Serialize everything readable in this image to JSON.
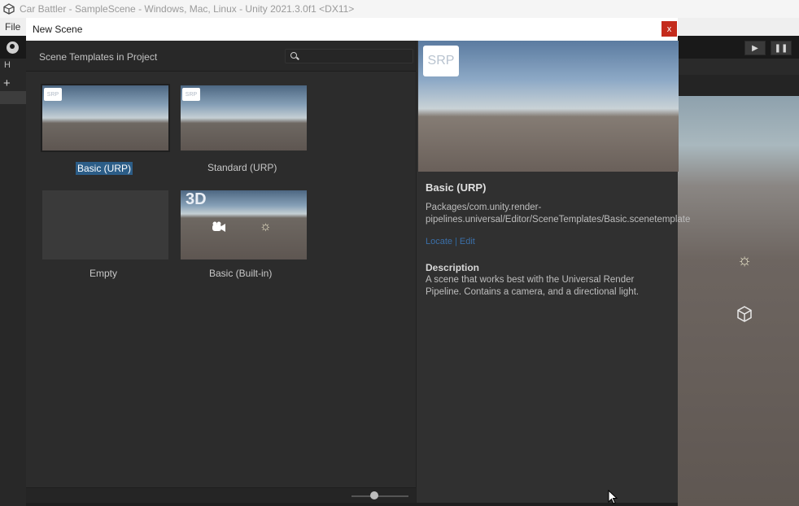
{
  "window": {
    "title": "Car Battler - SampleScene - Windows, Mac, Linux - Unity 2021.3.0f1 <DX11>",
    "menu": [
      "File"
    ]
  },
  "hierarchy": {
    "tab_label": "H"
  },
  "dialog": {
    "title": "New Scene",
    "close_label": "x",
    "templates_heading": "Scene Templates in Project",
    "search": {
      "value": "",
      "placeholder": ""
    },
    "templates": [
      {
        "label": "Basic (URP)",
        "thumbnail": "urp-sky",
        "badge": "SRP",
        "selected": true
      },
      {
        "label": "Standard (URP)",
        "thumbnail": "urp-sky",
        "badge": "SRP",
        "selected": false
      },
      {
        "label": "Empty",
        "thumbnail": "empty",
        "selected": false
      },
      {
        "label": "Basic (Built-in)",
        "thumbnail": "builtin-3d",
        "badge": "3D",
        "selected": false
      }
    ],
    "thumbnail_size": 0.4,
    "details": {
      "badge": "SRP",
      "title": "Basic (URP)",
      "path": "Packages/com.unity.render-pipelines.universal/Editor/SceneTemplates/Basic.scenetemplate",
      "links": [
        "Locate",
        "Edit"
      ],
      "description_heading": "Description",
      "description": "A scene that works best with the Universal Render Pipeline. Contains a camera, and a directional light."
    }
  },
  "icons": {
    "app": "unity-logo-icon",
    "account": "account-icon",
    "play": "play-icon",
    "pause": "pause-icon",
    "search": "search-icon",
    "camera": "camera-icon",
    "light": "directional-light-icon",
    "cube": "cube-icon"
  },
  "colors": {
    "selection": "#2c5d87",
    "close_button": "#c42b1c",
    "link": "#3b6fa8"
  }
}
